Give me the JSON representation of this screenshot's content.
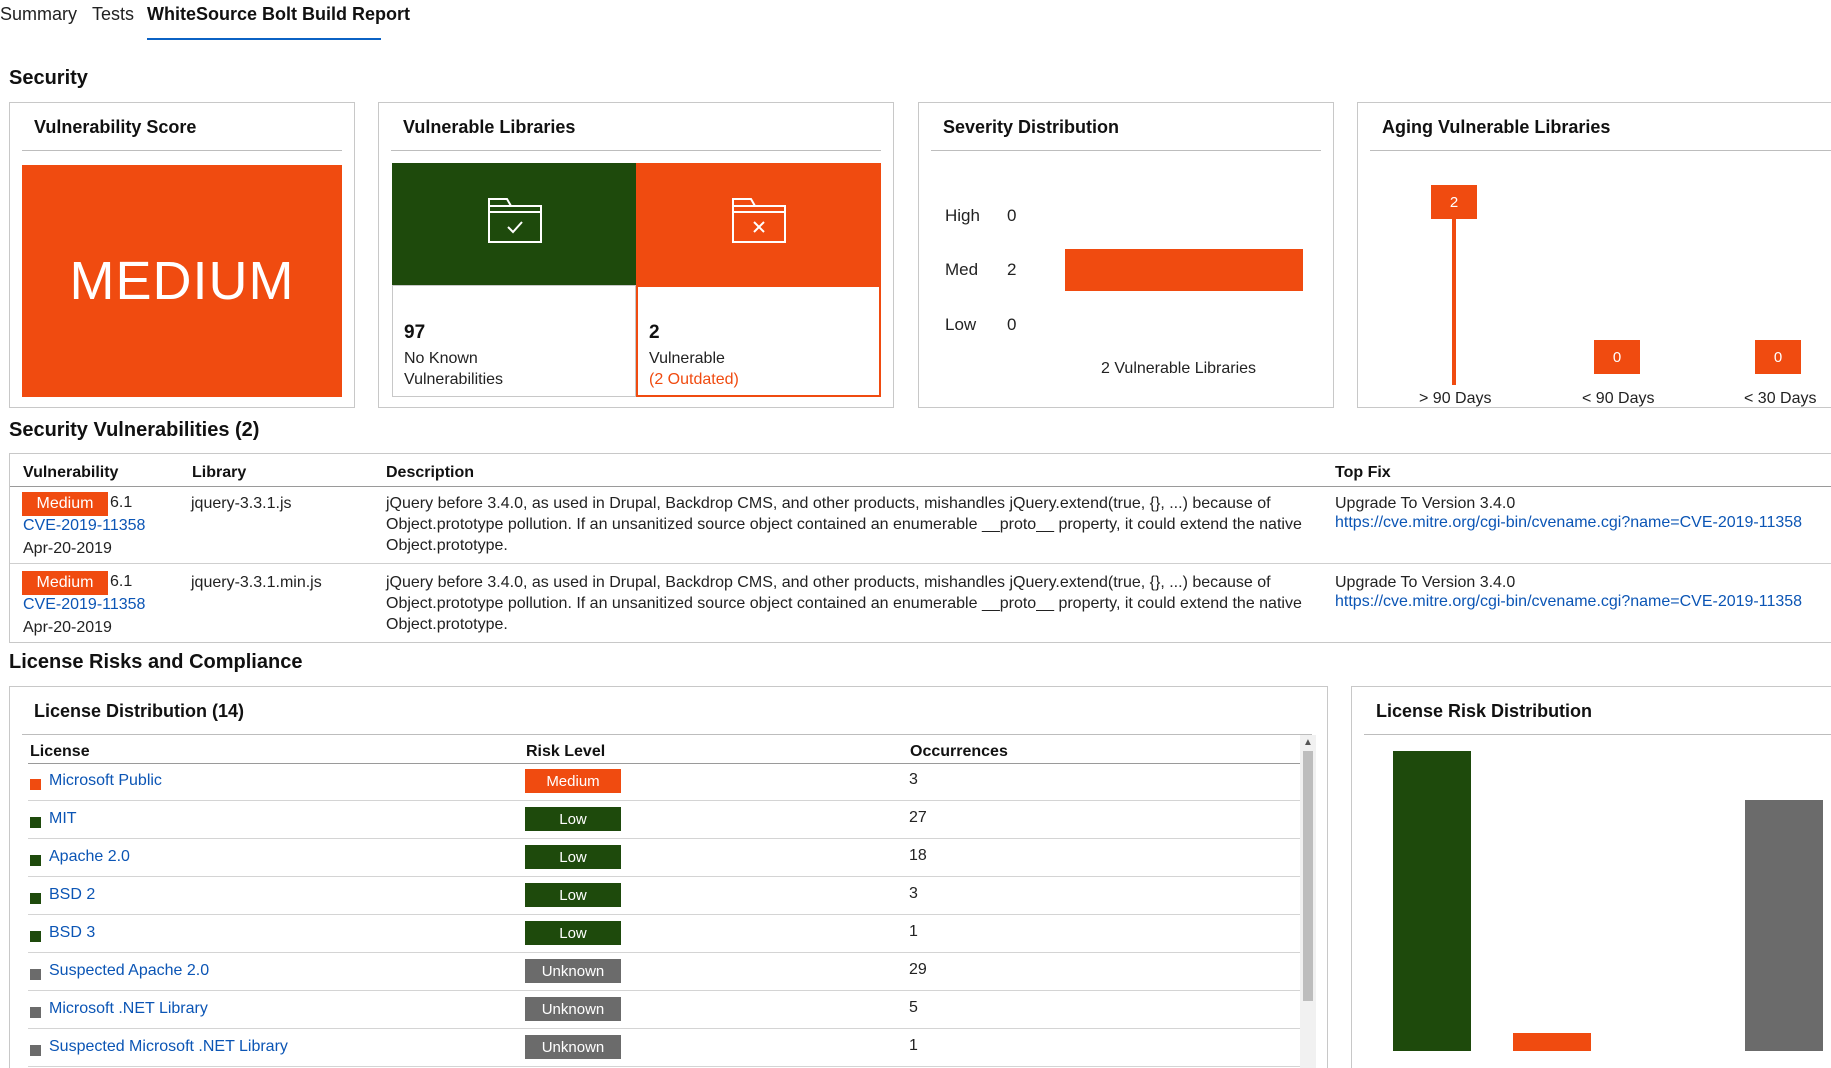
{
  "tabs": [
    {
      "label": "Summary"
    },
    {
      "label": "Tests"
    },
    {
      "label": "WhiteSource Bolt Build Report"
    }
  ],
  "security": {
    "title": "Security",
    "vulnerability_score": {
      "title": "Vulnerability Score",
      "value": "MEDIUM"
    },
    "vulnerable_libraries": {
      "title": "Vulnerable Libraries",
      "safe_count": "97",
      "safe_line1": "No Known",
      "safe_line2": "Vulnerabilities",
      "vuln_count": "2",
      "vuln_label": "Vulnerable",
      "vuln_outdated": "(2 Outdated)",
      "safe_icon": "folder-check-icon",
      "vuln_icon": "folder-x-icon"
    },
    "severity_distribution": {
      "title": "Severity Distribution",
      "rows": [
        {
          "label": "High",
          "count": "0"
        },
        {
          "label": "Med",
          "count": "2"
        },
        {
          "label": "Low",
          "count": "0"
        }
      ],
      "footer": "2 Vulnerable Libraries"
    },
    "aging": {
      "title": "Aging Vulnerable Libraries",
      "buckets": [
        {
          "label": "> 90 Days",
          "count": "2"
        },
        {
          "label": "< 90 Days",
          "count": "0"
        },
        {
          "label": "< 30 Days",
          "count": "0"
        }
      ]
    }
  },
  "vulnerabilities": {
    "title": "Security Vulnerabilities (2)",
    "headers": {
      "vulnerability": "Vulnerability",
      "library": "Library",
      "description": "Description",
      "top_fix": "Top Fix"
    },
    "rows": [
      {
        "severity": "Medium",
        "score": "6.1",
        "cve": "CVE-2019-11358",
        "date": "Apr-20-2019",
        "library": "jquery-3.3.1.js",
        "description_line1": "jQuery before 3.4.0, as used in Drupal, Backdrop CMS, and other products, mishandles jQuery.extend(true, {}, ...) because of",
        "description_line2": "Object.prototype pollution. If an unsanitized source object contained an enumerable __proto__ property, it could extend the native",
        "description_line3": "Object.prototype.",
        "fix": "Upgrade To Version 3.4.0",
        "fix_link": "https://cve.mitre.org/cgi-bin/cvename.cgi?name=CVE-2019-11358"
      },
      {
        "severity": "Medium",
        "score": "6.1",
        "cve": "CVE-2019-11358",
        "date": "Apr-20-2019",
        "library": "jquery-3.3.1.min.js",
        "description_line1": "jQuery before 3.4.0, as used in Drupal, Backdrop CMS, and other products, mishandles jQuery.extend(true, {}, ...) because of",
        "description_line2": "Object.prototype pollution. If an unsanitized source object contained an enumerable __proto__ property, it could extend the native",
        "description_line3": "Object.prototype.",
        "fix": "Upgrade To Version 3.4.0",
        "fix_link": "https://cve.mitre.org/cgi-bin/cvename.cgi?name=CVE-2019-11358"
      }
    ]
  },
  "license": {
    "title": "License Risks and Compliance",
    "distribution": {
      "title": "License Distribution (14)",
      "headers": {
        "license": "License",
        "risk": "Risk Level",
        "occurrences": "Occurrences"
      },
      "rows": [
        {
          "name": "Microsoft Public",
          "risk": "Medium",
          "occurrences": "3",
          "color": "#f04b10"
        },
        {
          "name": "MIT",
          "risk": "Low",
          "occurrences": "27",
          "color": "#1e4a0c"
        },
        {
          "name": "Apache 2.0",
          "risk": "Low",
          "occurrences": "18",
          "color": "#1e4a0c"
        },
        {
          "name": "BSD 2",
          "risk": "Low",
          "occurrences": "3",
          "color": "#1e4a0c"
        },
        {
          "name": "BSD 3",
          "risk": "Low",
          "occurrences": "1",
          "color": "#1e4a0c"
        },
        {
          "name": "Suspected Apache 2.0",
          "risk": "Unknown",
          "occurrences": "29",
          "color": "#6b6b6b"
        },
        {
          "name": "Microsoft .NET Library",
          "risk": "Unknown",
          "occurrences": "5",
          "color": "#6b6b6b"
        },
        {
          "name": "Suspected Microsoft .NET Library",
          "risk": "Unknown",
          "occurrences": "1",
          "color": "#6b6b6b"
        }
      ]
    },
    "risk_distribution": {
      "title": "License Risk Distribution"
    }
  },
  "colors": {
    "accent": "#f04b10",
    "low": "#1e4a0c",
    "unknown": "#6b6b6b",
    "link": "#0b55b5",
    "tab_underline": "#0b62c4"
  }
}
